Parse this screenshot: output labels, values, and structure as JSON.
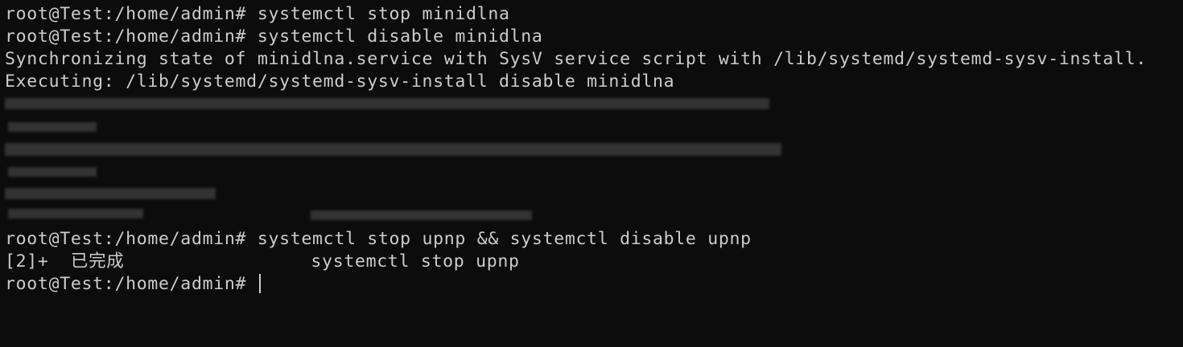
{
  "terminal": {
    "lines_top": [
      "root@Test:/home/admin# systemctl stop minidlna",
      "root@Test:/home/admin# systemctl disable minidlna",
      "Synchronizing state of minidlna.service with SysV service script with /lib/systemd/systemd-sysv-install.",
      "Executing: /lib/systemd/systemd-sysv-install disable minidlna"
    ],
    "lines_bottom": [
      "root@Test:/home/admin# systemctl stop upnp && systemctl disable upnp",
      "[2]+  已完成                 systemctl stop upnp"
    ],
    "prompt": "root@Test:/home/admin# "
  },
  "colors": {
    "background": "#0c0c0c",
    "foreground": "#cccccc"
  }
}
